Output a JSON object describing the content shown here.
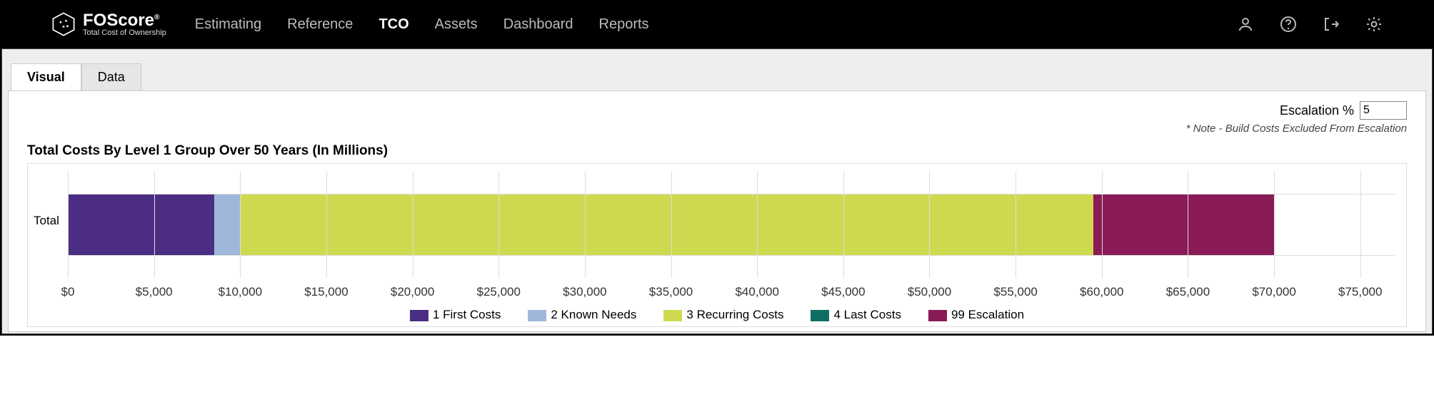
{
  "brand": {
    "name": "FOScore",
    "reg": "®",
    "tagline": "Total Cost of Ownership"
  },
  "nav": {
    "items": [
      "Estimating",
      "Reference",
      "TCO",
      "Assets",
      "Dashboard",
      "Reports"
    ],
    "active_index": 2
  },
  "tabs": {
    "items": [
      "Visual",
      "Data"
    ],
    "active_index": 0
  },
  "escalation": {
    "label": "Escalation %",
    "value": "5"
  },
  "note": "* Note - Build Costs Excluded From Escalation",
  "chart_data": {
    "type": "bar",
    "orientation": "horizontal-stacked",
    "title": "Total Costs By Level 1 Group Over 50 Years (In Millions)",
    "categories": [
      "Total"
    ],
    "xlabel": "",
    "ylabel": "",
    "xlim": [
      0,
      77000
    ],
    "x_ticks": [
      0,
      5000,
      10000,
      15000,
      20000,
      25000,
      30000,
      35000,
      40000,
      45000,
      50000,
      55000,
      60000,
      65000,
      70000,
      75000
    ],
    "x_tick_labels": [
      "$0",
      "$5,000",
      "$10,000",
      "$15,000",
      "$20,000",
      "$25,000",
      "$30,000",
      "$35,000",
      "$40,000",
      "$45,000",
      "$50,000",
      "$55,000",
      "$60,000",
      "$65,000",
      "$70,000",
      "$75,000"
    ],
    "series": [
      {
        "name": "1 First Costs",
        "color": "#4b2e83",
        "values": [
          8500
        ]
      },
      {
        "name": "2 Known Needs",
        "color": "#9fb7db",
        "values": [
          1500
        ]
      },
      {
        "name": "3 Recurring Costs",
        "color": "#cfd94f",
        "values": [
          49500
        ]
      },
      {
        "name": "4 Last Costs",
        "color": "#0f6e63",
        "values": [
          0
        ]
      },
      {
        "name": "99 Escalation",
        "color": "#8a1b57",
        "values": [
          10500
        ]
      }
    ]
  }
}
